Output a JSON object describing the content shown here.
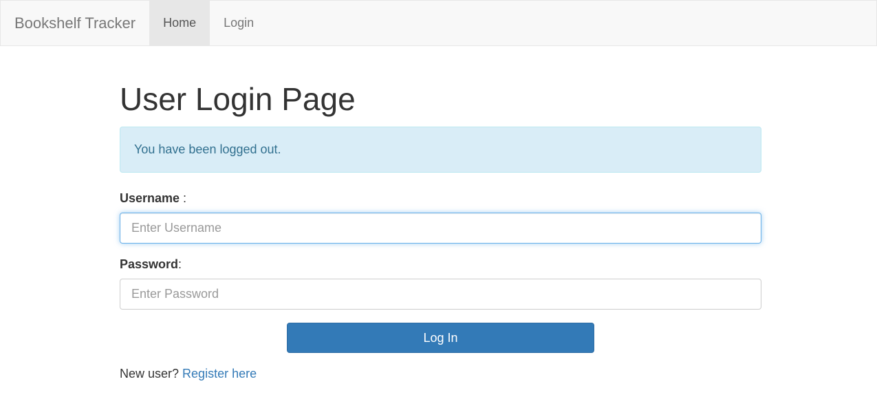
{
  "navbar": {
    "brand": "Bookshelf Tracker",
    "items": [
      {
        "label": "Home",
        "active": true
      },
      {
        "label": "Login",
        "active": false
      }
    ]
  },
  "main": {
    "title": "User Login Page",
    "alert": "You have been logged out.",
    "username": {
      "label": "Username",
      "label_suffix": " :",
      "placeholder": "Enter Username",
      "value": ""
    },
    "password": {
      "label": "Password",
      "label_suffix": ":",
      "placeholder": "Enter Password",
      "value": ""
    },
    "submit_label": "Log In",
    "register_prompt": "New user? ",
    "register_link": "Register here"
  },
  "colors": {
    "primary": "#337ab7",
    "alert_bg": "#d9edf7",
    "alert_text": "#31708f",
    "navbar_bg": "#f8f8f8"
  }
}
